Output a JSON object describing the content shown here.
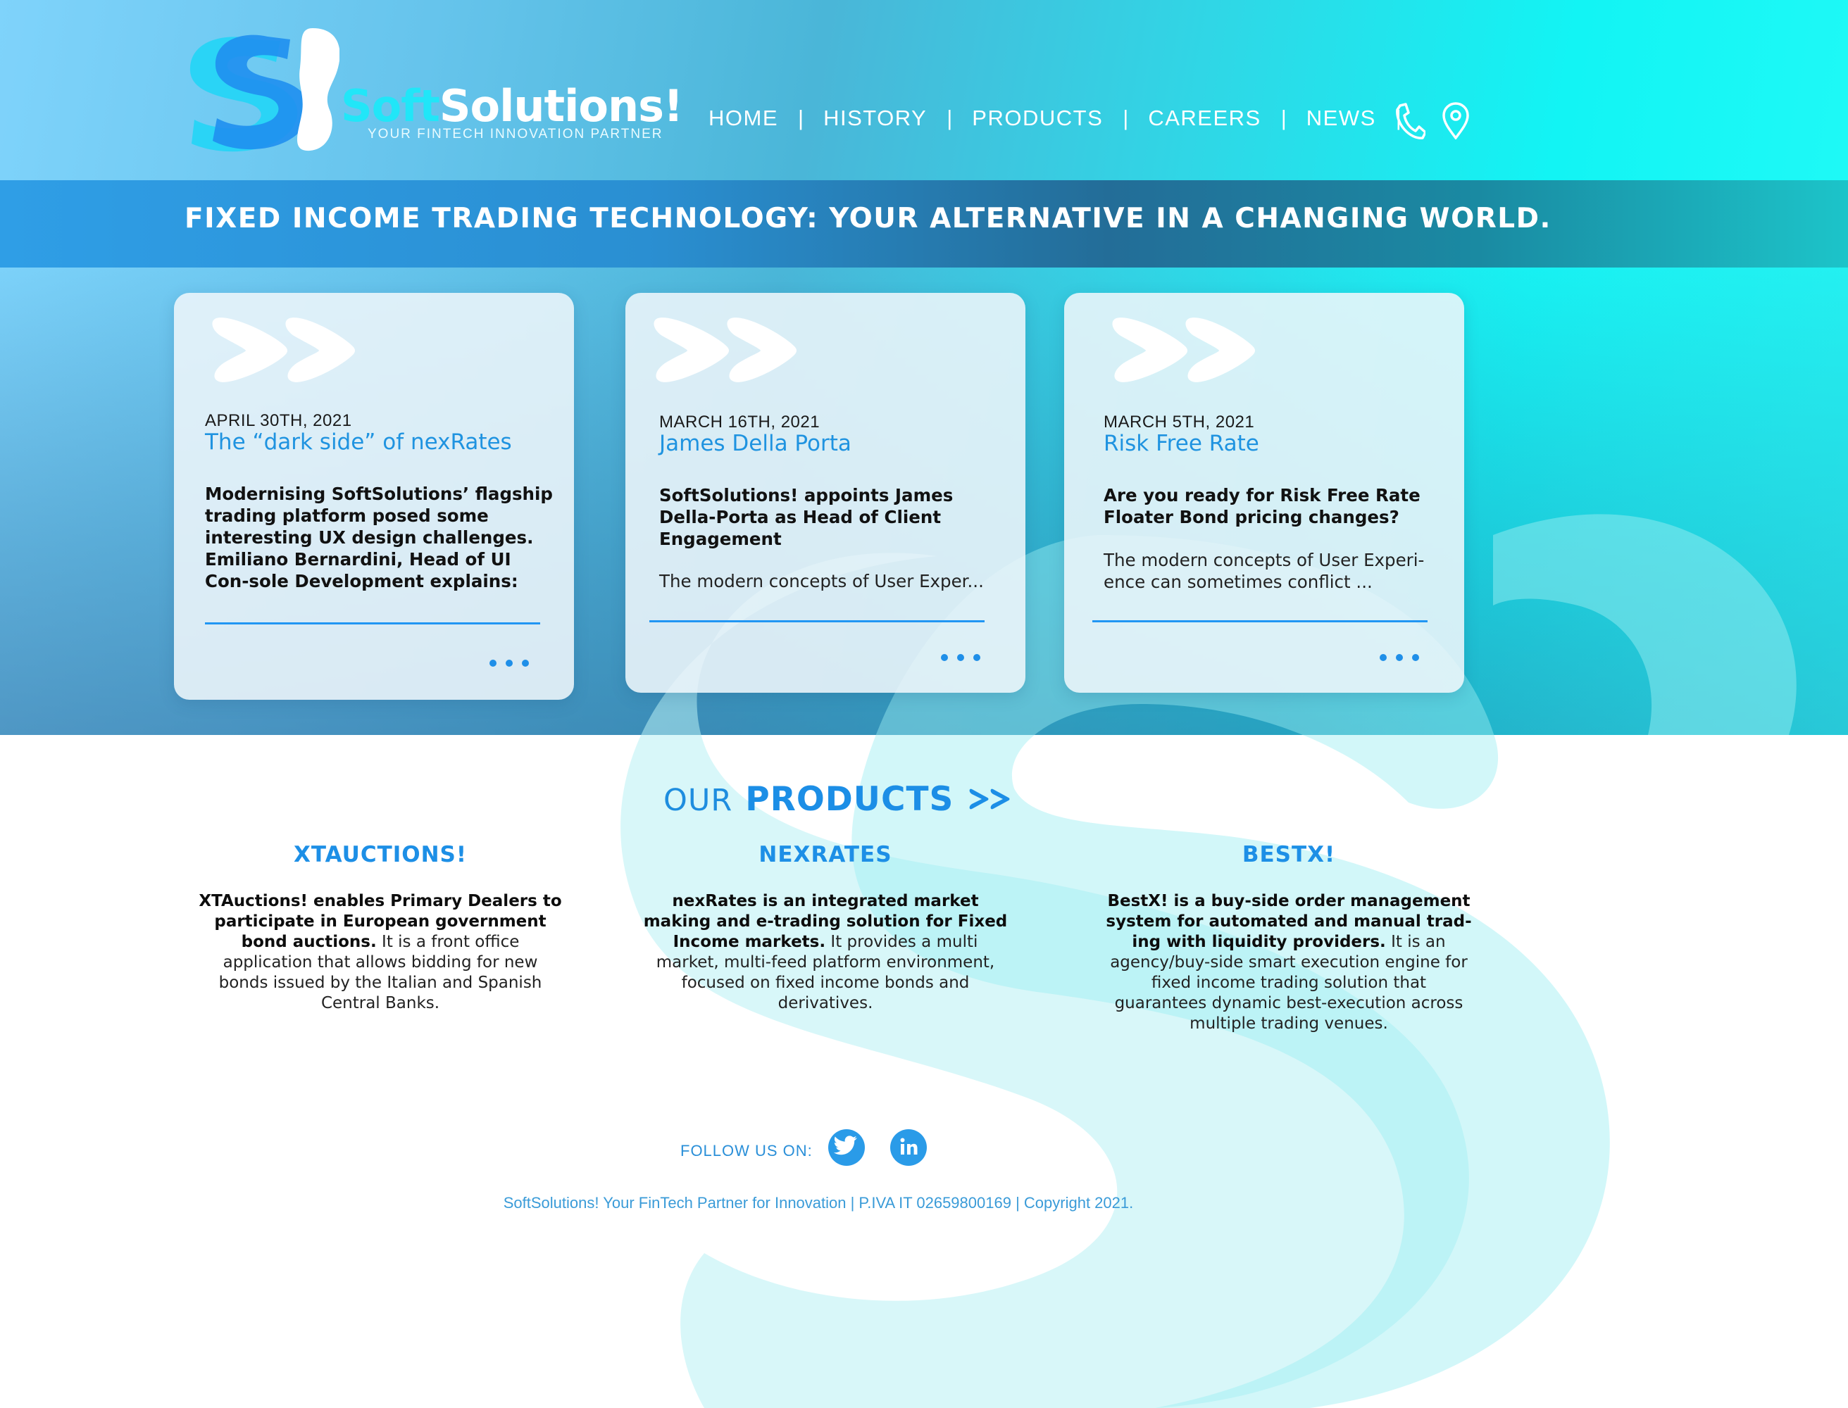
{
  "brand": {
    "name_part1": "Soft",
    "name_part2": "Solutions!",
    "tagline": "YOUR FINTECH INNOVATION PARTNER",
    "logo_icon": "softsolutions-s-logo"
  },
  "nav": {
    "items": [
      "HOME",
      "HISTORY",
      "PRODUCTS",
      "CAREERS",
      "NEWS"
    ],
    "separator": "|",
    "icons": [
      "phone-icon",
      "location-pin-icon"
    ]
  },
  "banner": {
    "text": "FIXED INCOME TRADING TECHNOLOGY: YOUR ALTERNATIVE IN A CHANGING WORLD."
  },
  "news": [
    {
      "date": "APRIL 30TH, 2021",
      "title": "The “dark side” of nexRates",
      "lead": "Modernising SoftSolutions’ flagship trading platform posed some interesting UX design challenges. Emiliano Bernardini, Head of UI Con-sole Development explains:",
      "body": ""
    },
    {
      "date": "MARCH 16TH, 2021",
      "title": "James Della Porta",
      "lead": "SoftSolutions! appoints James Della-Porta as Head of Client Engagement",
      "body": "The modern concepts of User Exper..."
    },
    {
      "date": "MARCH 5TH, 2021",
      "title": "Risk Free Rate",
      "lead": "Are you ready for Risk Free Rate Floater Bond pricing changes?",
      "body": "The modern concepts of User Experi-ence can sometimes conflict ..."
    }
  ],
  "products": {
    "heading_our": "OUR",
    "heading_products": "PRODUCTS",
    "items": [
      {
        "name": "XTAUCTIONS!",
        "bold": "XTAuctions! enables Primary Dealers to participate in European government bond auctions.",
        "text": " It is a front office application that allows bidding for new bonds issued by the Italian and Spanish Central Banks."
      },
      {
        "name": "NEXRATES",
        "bold": "nexRates is an integrated market making and e-trading solution for Fixed Income markets.",
        "text": " It provides a multi market, multi-feed platform environment, focused on fixed income bonds and derivatives."
      },
      {
        "name": "BESTX!",
        "bold": "BestX! is a buy-side order management system for automated and manual trad-ing with liquidity providers.",
        "text": " It is an agency/buy-side smart execution engine for fixed income trading solution that guarantees dynamic best-execution across multiple trading venues."
      }
    ]
  },
  "footer": {
    "follow_label": "FOLLOW US ON:",
    "social_icons": [
      "twitter-icon",
      "linkedin-icon"
    ],
    "copyright": "SoftSolutions! Your FinTech Partner for Innovation | P.IVA IT 02659800169 | Copyright 2021."
  },
  "colors": {
    "accent": "#1f93e0",
    "cyan": "#1cf4f4",
    "card_bg": "#eef6fa"
  }
}
